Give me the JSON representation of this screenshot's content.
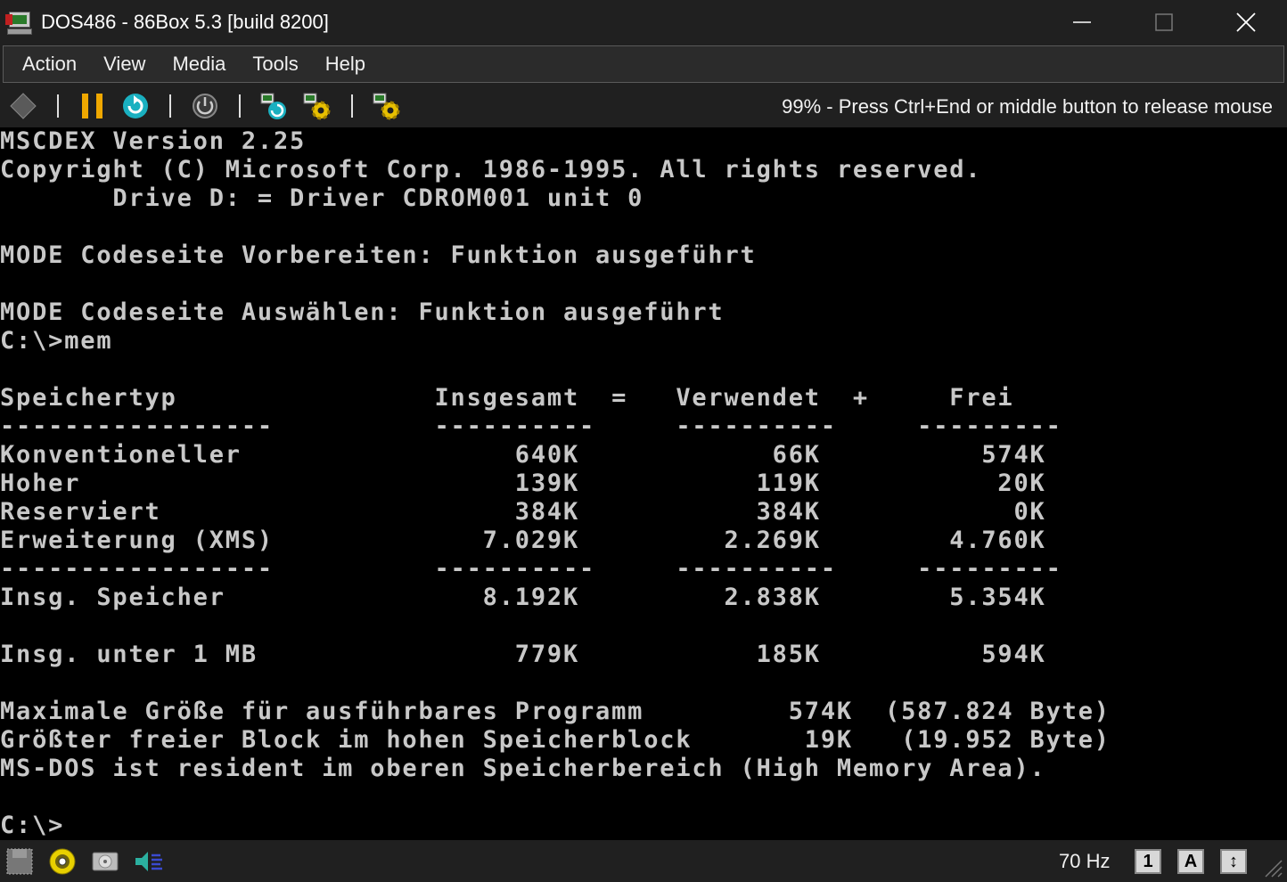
{
  "window": {
    "title": "DOS486 - 86Box 5.3 [build 8200]"
  },
  "menu": {
    "items": [
      {
        "label": "Action"
      },
      {
        "label": "View"
      },
      {
        "label": "Media"
      },
      {
        "label": "Tools"
      },
      {
        "label": "Help"
      }
    ]
  },
  "toolbar": {
    "status_text": "99% - Press Ctrl+End or middle button to release mouse",
    "icons": [
      "input-capture-icon",
      "pause-icon",
      "reset-icon",
      "power-icon",
      "settings-reset-icon",
      "hard-reset-settings-icon",
      "settings-icon"
    ]
  },
  "screen": {
    "lines": [
      "MSCDEX Version 2.25",
      "Copyright (C) Microsoft Corp. 1986-1995. All rights reserved.",
      "       Drive D: = Driver CDROM001 unit 0",
      "",
      "MODE Codeseite Vorbereiten: Funktion ausgeführt",
      "",
      "MODE Codeseite Auswählen: Funktion ausgeführt",
      "C:\\>mem",
      "",
      "Speichertyp                Insgesamt  =   Verwendet  +     Frei",
      "-----------------          ----------     ----------     ---------",
      "Konventioneller                 640K            66K          574K",
      "Hoher                           139K           119K           20K",
      "Reserviert                      384K           384K            0K",
      "Erweiterung (XMS)             7.029K         2.269K        4.760K",
      "-----------------          ----------     ----------     ---------",
      "Insg. Speicher                8.192K         2.838K        5.354K",
      "",
      "Insg. unter 1 MB                779K           185K          594K",
      "",
      "Maximale Größe für ausführbares Programm         574K  (587.824 Byte)",
      "Größter freier Block im hohen Speicherblock       19K   (19.952 Byte)",
      "MS-DOS ist resident im oberen Speicherbereich (High Memory Area).",
      "",
      "C:\\>"
    ]
  },
  "statusbar": {
    "refresh_rate": "70 Hz",
    "keys": [
      {
        "label": "1",
        "name": "num-lock-indicator"
      },
      {
        "label": "A",
        "name": "caps-lock-indicator"
      },
      {
        "label": "↕",
        "name": "scroll-lock-indicator"
      }
    ],
    "icons": [
      "floppy-icon",
      "cdrom-icon",
      "hard-disk-icon",
      "sound-icon"
    ]
  }
}
